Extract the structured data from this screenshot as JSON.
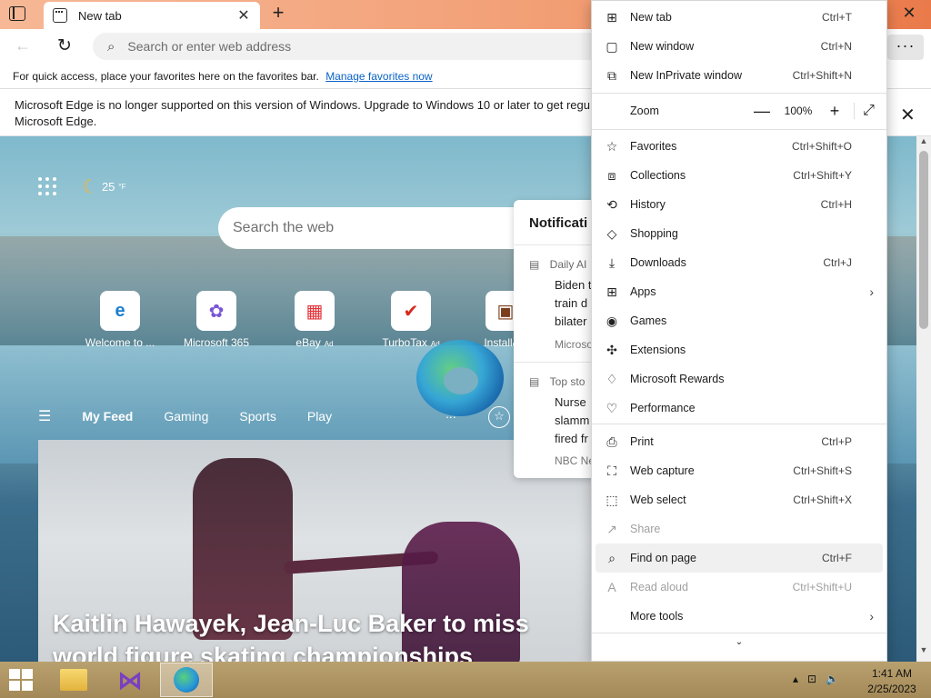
{
  "tab": {
    "title": "New tab"
  },
  "address": {
    "placeholder": "Search or enter web address"
  },
  "favorites_bar": {
    "text": "For quick access, place your favorites here on the favorites bar.",
    "link": "Manage favorites now"
  },
  "info_bar": {
    "line1": "Microsoft Edge is no longer supported on this version of Windows. Upgrade to Windows 10 or later to get regu",
    "line2": "Microsoft Edge."
  },
  "newtab_page": {
    "weather": "25",
    "weather_unit": "°F",
    "search_placeholder": "Search the web",
    "tiles": [
      {
        "label": "Welcome to ...",
        "glyph": "e",
        "color": "#1a7fd0"
      },
      {
        "label": "Microsoft 365",
        "glyph": "✿",
        "color": "#7a55d6"
      },
      {
        "label": "eBay",
        "ad": "Ad",
        "glyph": "▦",
        "color": "#e43137"
      },
      {
        "label": "TurboTax",
        "ad": "Ad",
        "glyph": "✔",
        "color": "#d52b1e"
      },
      {
        "label": "Install&P",
        "glyph": "▣",
        "color": "#7b3f1e"
      }
    ],
    "feed_tabs": [
      "My Feed",
      "Gaming",
      "Sports",
      "Play"
    ],
    "feed_more": "...",
    "headline": "Kaitlin Hawayek, Jean-Luc Baker to miss world figure skating championships"
  },
  "notifications": {
    "title": "Notificati",
    "items": [
      {
        "category": "Daily AI",
        "lines": [
          "Biden t",
          "train d",
          "bilater"
        ],
        "source": "Microso"
      },
      {
        "category": "Top sto",
        "lines": [
          "Nurse",
          "slamm",
          "fired fr"
        ],
        "source": "NBC Ne"
      }
    ]
  },
  "menu": {
    "items_top": [
      {
        "label": "New tab",
        "shortcut": "Ctrl+T",
        "icon": "new-tab-icon",
        "glyph": "⊞"
      },
      {
        "label": "New window",
        "shortcut": "Ctrl+N",
        "icon": "window-icon",
        "glyph": "▢"
      },
      {
        "label": "New InPrivate window",
        "shortcut": "Ctrl+Shift+N",
        "icon": "inprivate-icon",
        "glyph": "⧉"
      }
    ],
    "zoom": {
      "label": "Zoom",
      "value": "100%",
      "minus": "—",
      "plus": "+",
      "fullscreen": "⤢"
    },
    "items_mid": [
      {
        "label": "Favorites",
        "shortcut": "Ctrl+Shift+O",
        "glyph": "☆"
      },
      {
        "label": "Collections",
        "shortcut": "Ctrl+Shift+Y",
        "glyph": "⧈"
      },
      {
        "label": "History",
        "shortcut": "Ctrl+H",
        "glyph": "⟲"
      },
      {
        "label": "Shopping",
        "shortcut": "",
        "glyph": "◇"
      },
      {
        "label": "Downloads",
        "shortcut": "Ctrl+J",
        "glyph": "⤓"
      },
      {
        "label": "Apps",
        "shortcut": "",
        "glyph": "⊞",
        "arrow": "›"
      },
      {
        "label": "Games",
        "shortcut": "",
        "glyph": "◉"
      },
      {
        "label": "Extensions",
        "shortcut": "",
        "glyph": "✣"
      },
      {
        "label": "Microsoft Rewards",
        "shortcut": "",
        "glyph": "♢"
      },
      {
        "label": "Performance",
        "shortcut": "",
        "glyph": "♡"
      }
    ],
    "items_bottom": [
      {
        "label": "Print",
        "shortcut": "Ctrl+P",
        "glyph": "⎙"
      },
      {
        "label": "Web capture",
        "shortcut": "Ctrl+Shift+S",
        "glyph": "⛶"
      },
      {
        "label": "Web select",
        "shortcut": "Ctrl+Shift+X",
        "glyph": "⬚"
      },
      {
        "label": "Share",
        "shortcut": "",
        "glyph": "↗",
        "disabled": true
      },
      {
        "label": "Find on page",
        "shortcut": "Ctrl+F",
        "glyph": "⌕",
        "highlighted": true
      },
      {
        "label": "Read aloud",
        "shortcut": "Ctrl+Shift+U",
        "glyph": "A",
        "disabled": true
      },
      {
        "label": "More tools",
        "shortcut": "",
        "glyph": "",
        "arrow": "›"
      }
    ],
    "expand": "⌄"
  },
  "taskbar": {
    "time": "1:41 AM",
    "date": "2/25/2023"
  },
  "colors": {
    "accent": "#0a63c7",
    "titlebar": "#f29e74",
    "taskbar": "#ad9461"
  }
}
